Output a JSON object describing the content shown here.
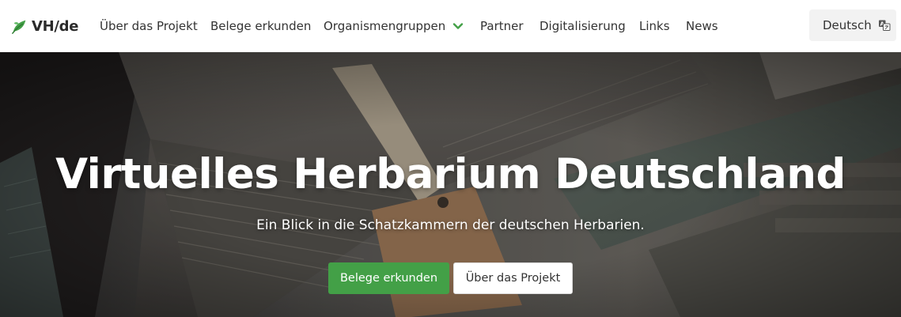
{
  "brand": {
    "name": "VH/de",
    "icon": "leaf-logo-icon",
    "color": "#43a047"
  },
  "nav": {
    "items": [
      {
        "label": "Über das Projekt"
      },
      {
        "label": "Belege erkunden"
      },
      {
        "label": "Organismengruppen",
        "dropdown": true,
        "icon": "chevron-down-icon"
      },
      {
        "label": "Partner"
      },
      {
        "label": "Digitalisierung"
      },
      {
        "label": "Links"
      },
      {
        "label": "News"
      }
    ],
    "language": {
      "label": "Deutsch",
      "icon": "translate-icon"
    }
  },
  "hero": {
    "title": "Virtuelles Herbarium Deutschland",
    "subtitle": "Ein Blick in die Schatzkammern der deutschen Herbarien.",
    "primary_button": "Belege erkunden",
    "secondary_button": "Über das Projekt"
  },
  "colors": {
    "accent": "#43a047",
    "nav_background": "#ffffff",
    "language_button_background": "#f2f2f2"
  }
}
